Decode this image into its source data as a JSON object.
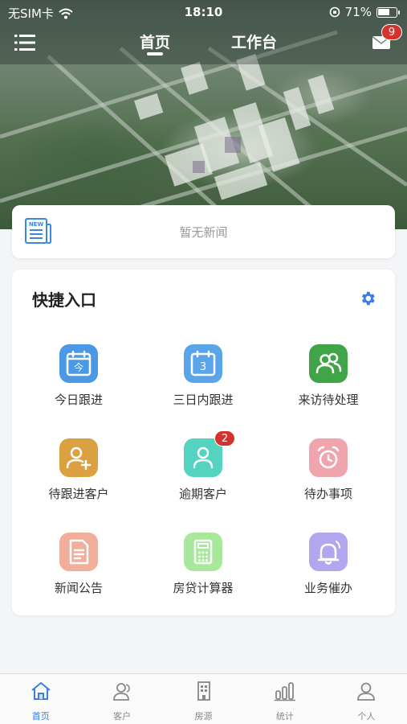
{
  "status_bar": {
    "carrier": "无SIM卡",
    "time": "18:10",
    "battery": "71%",
    "battery_level": 0.71
  },
  "header": {
    "tabs": [
      "首页",
      "工作台"
    ],
    "active_tab": "首页",
    "mail_badge": "9"
  },
  "news": {
    "empty_text": "暂无新闻",
    "icon_text": "NEW"
  },
  "quick_entry": {
    "title": "快捷入口",
    "items": [
      {
        "label": "今日跟进",
        "icon": "calendar-today-icon",
        "icon_text": "今",
        "color": "#4a98e6"
      },
      {
        "label": "三日内跟进",
        "icon": "calendar-three-icon",
        "icon_text": "3",
        "color": "#5aa5ea"
      },
      {
        "label": "来访待处理",
        "icon": "visitors-icon",
        "color": "#3fa548"
      },
      {
        "label": "待跟进客户",
        "icon": "add-user-icon",
        "color": "#dba040"
      },
      {
        "label": "逾期客户",
        "icon": "user-icon",
        "color": "#55d3c1",
        "badge": "2"
      },
      {
        "label": "待办事项",
        "icon": "alarm-clock-icon",
        "color": "#f0a4ad"
      },
      {
        "label": "新闻公告",
        "icon": "document-icon",
        "color": "#f1ae9a"
      },
      {
        "label": "房贷计算器",
        "icon": "calculator-icon",
        "color": "#a8e89b"
      },
      {
        "label": "业务催办",
        "icon": "bell-icon",
        "color": "#b1a7ee"
      }
    ]
  },
  "tab_bar": {
    "items": [
      {
        "label": "首页",
        "icon": "home-icon"
      },
      {
        "label": "客户",
        "icon": "customers-icon"
      },
      {
        "label": "房源",
        "icon": "building-icon"
      },
      {
        "label": "统计",
        "icon": "chart-icon"
      },
      {
        "label": "个人",
        "icon": "person-icon"
      }
    ],
    "active": "首页"
  },
  "colors": {
    "accent": "#3b7de9",
    "badge": "#d2332c"
  }
}
